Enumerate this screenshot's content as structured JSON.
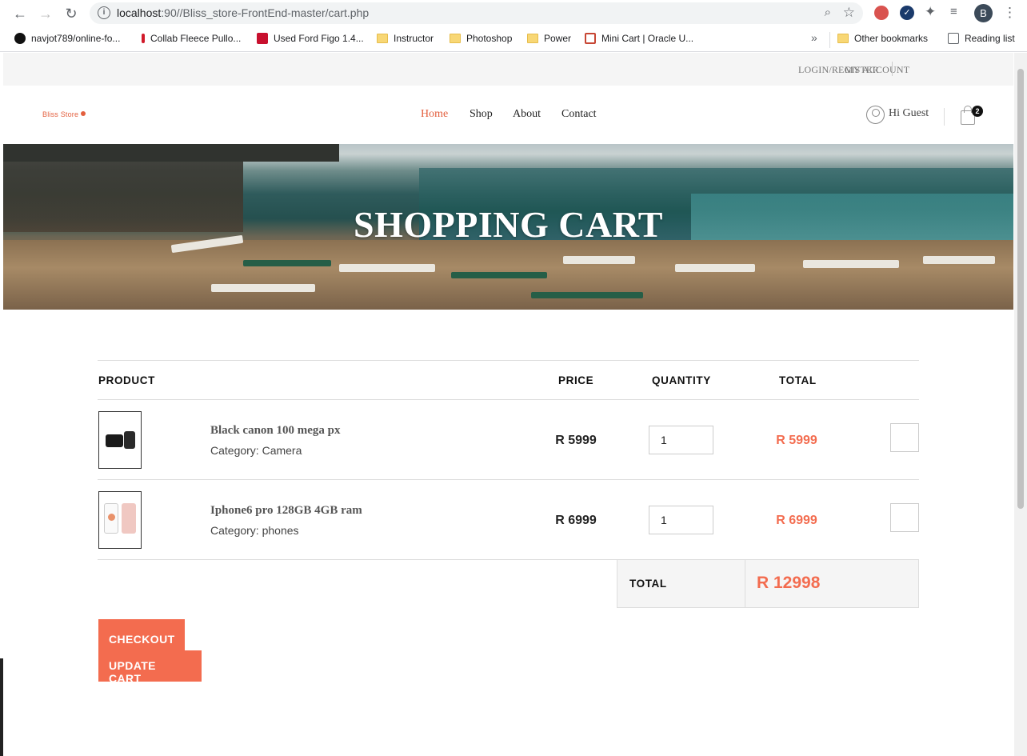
{
  "browser": {
    "url_host": "localhost",
    "url_rest": ":90//Bliss_store-FrontEnd-master/cart.php",
    "profile_initial": "B",
    "bookmarks": [
      {
        "label": "navjot789/online-fo...",
        "icon": "github-icon"
      },
      {
        "label": "Collab Fleece Pullo...",
        "icon": "bookmark-dot-icon"
      },
      {
        "label": "Used Ford Figo 1.4...",
        "icon": "site-icon"
      },
      {
        "label": "Instructor",
        "icon": "folder-icon"
      },
      {
        "label": "Photoshop",
        "icon": "folder-icon"
      },
      {
        "label": "Power",
        "icon": "folder-icon"
      },
      {
        "label": "Mini Cart | Oracle U...",
        "icon": "oracle-icon"
      }
    ],
    "more_label": "»",
    "other_bookmarks": "Other bookmarks",
    "reading_list": "Reading list"
  },
  "topbar": {
    "login_register": "LOGIN/REGISTER",
    "my_account": "MY ACCOUNT"
  },
  "header": {
    "logo": "Bliss Store",
    "nav": [
      "Home",
      "Shop",
      "About",
      "Contact"
    ],
    "active_nav": "Home",
    "greeting": "Hi Guest",
    "cart_count": "2"
  },
  "hero": {
    "title": "SHOPPING CART"
  },
  "cart": {
    "headers": {
      "product": "PRODUCT",
      "price": "PRICE",
      "quantity": "QUANTITY",
      "total": "TOTAL"
    },
    "items": [
      {
        "name": "Black canon 100 mega px",
        "category": "Category: Camera",
        "price": "R 5999",
        "quantity": "1",
        "total": "R 5999"
      },
      {
        "name": "Iphone6 pro 128GB 4GB ram",
        "category": "Category: phones",
        "price": "R 6999",
        "quantity": "1",
        "total": "R 6999"
      }
    ],
    "total_label": "TOTAL",
    "grand_total": "R 12998",
    "checkout_label": "CHECKOUT",
    "update_label": "UPDATE CART"
  },
  "colors": {
    "accent": "#f36c4f",
    "logo": "#e35f3e"
  }
}
